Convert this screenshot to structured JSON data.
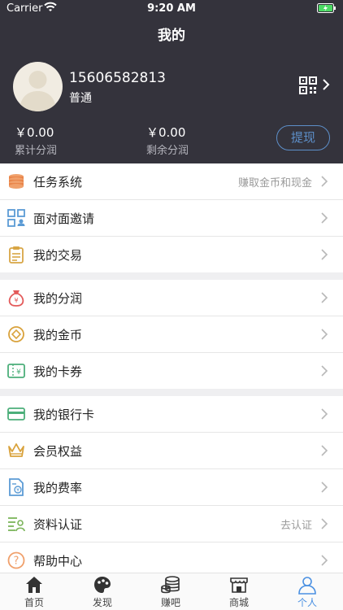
{
  "status_bar": {
    "carrier": "Carrier",
    "time": "9:20 AM"
  },
  "nav": {
    "title": "我的"
  },
  "profile": {
    "phone": "15606582813",
    "level": "普通",
    "accum_amount": "￥0.00",
    "accum_label": "累计分润",
    "remain_amount": "￥0.00",
    "remain_label": "剩余分润",
    "withdraw_label": "提现"
  },
  "menu": [
    {
      "label": "任务系统",
      "sub": "赚取金币和现金",
      "icon": "coins-stack-icon"
    },
    {
      "label": "面对面邀请",
      "sub": "",
      "icon": "qr-invite-icon"
    },
    {
      "label": "我的交易",
      "sub": "",
      "icon": "clipboard-icon"
    },
    {
      "label": "我的分润",
      "sub": "",
      "icon": "money-bag-icon"
    },
    {
      "label": "我的金币",
      "sub": "",
      "icon": "gold-coin-icon"
    },
    {
      "label": "我的卡券",
      "sub": "",
      "icon": "ticket-icon"
    },
    {
      "label": "我的银行卡",
      "sub": "",
      "icon": "bank-card-icon"
    },
    {
      "label": "会员权益",
      "sub": "",
      "icon": "crown-icon"
    },
    {
      "label": "我的费率",
      "sub": "",
      "icon": "rate-document-icon"
    },
    {
      "label": "资料认证",
      "sub": "去认证",
      "icon": "id-card-icon"
    },
    {
      "label": "帮助中心",
      "sub": "",
      "icon": "help-icon"
    }
  ],
  "tabs": [
    {
      "label": "首页",
      "icon": "home-icon"
    },
    {
      "label": "发现",
      "icon": "discover-icon"
    },
    {
      "label": "赚吧",
      "icon": "coins-icon"
    },
    {
      "label": "商城",
      "icon": "store-icon"
    },
    {
      "label": "个人",
      "icon": "person-icon",
      "active": true
    }
  ],
  "colors": {
    "header_bg": "#34333c",
    "accent": "#4a90e2",
    "withdraw": "#5d8fc9"
  }
}
